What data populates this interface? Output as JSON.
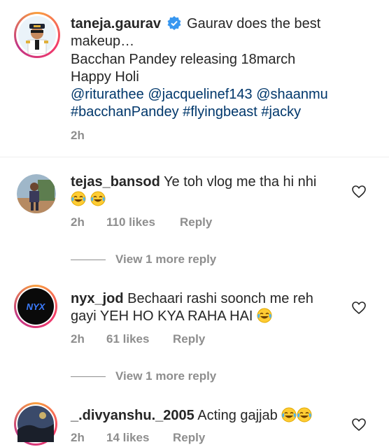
{
  "caption": {
    "username": "taneja.gaurav",
    "text_line1": "Gaurav does the best",
    "text_line2": "makeup…",
    "text_line3": "Bacchan Pandey releasing 18march",
    "text_line4": "Happy Holi",
    "mentions_line": "@riturathee @jacquelinef143 @shaanmu",
    "hashtags_line": "#bacchanPandey #flyingbeast #jacky",
    "time": "2h"
  },
  "comments": [
    {
      "username": "tejas_bansod",
      "text": "Ye toh vlog me tha hi nhi",
      "time": "2h",
      "likes": "110 likes",
      "reply_label": "Reply",
      "view_more": "View 1 more reply"
    },
    {
      "username": "nyx_jod",
      "text_line1": "Bechaari rashi soonch me reh",
      "text_line2": "gayi YEH HO KYA RAHA HAI",
      "avatar_text": "NYX",
      "time": "2h",
      "likes": "61 likes",
      "reply_label": "Reply",
      "view_more": "View 1 more reply"
    },
    {
      "username": "_.divyanshu._2005",
      "text": "Acting gajjab",
      "time": "2h",
      "likes": "14 likes",
      "reply_label": "Reply"
    }
  ],
  "colors": {
    "link": "#00376b",
    "muted": "#8e8e8e",
    "verified": "#3897f0"
  },
  "icons": {
    "verified": "verified-badge-icon",
    "like": "heart-outline-icon",
    "emoji": "tears-of-joy-emoji"
  }
}
